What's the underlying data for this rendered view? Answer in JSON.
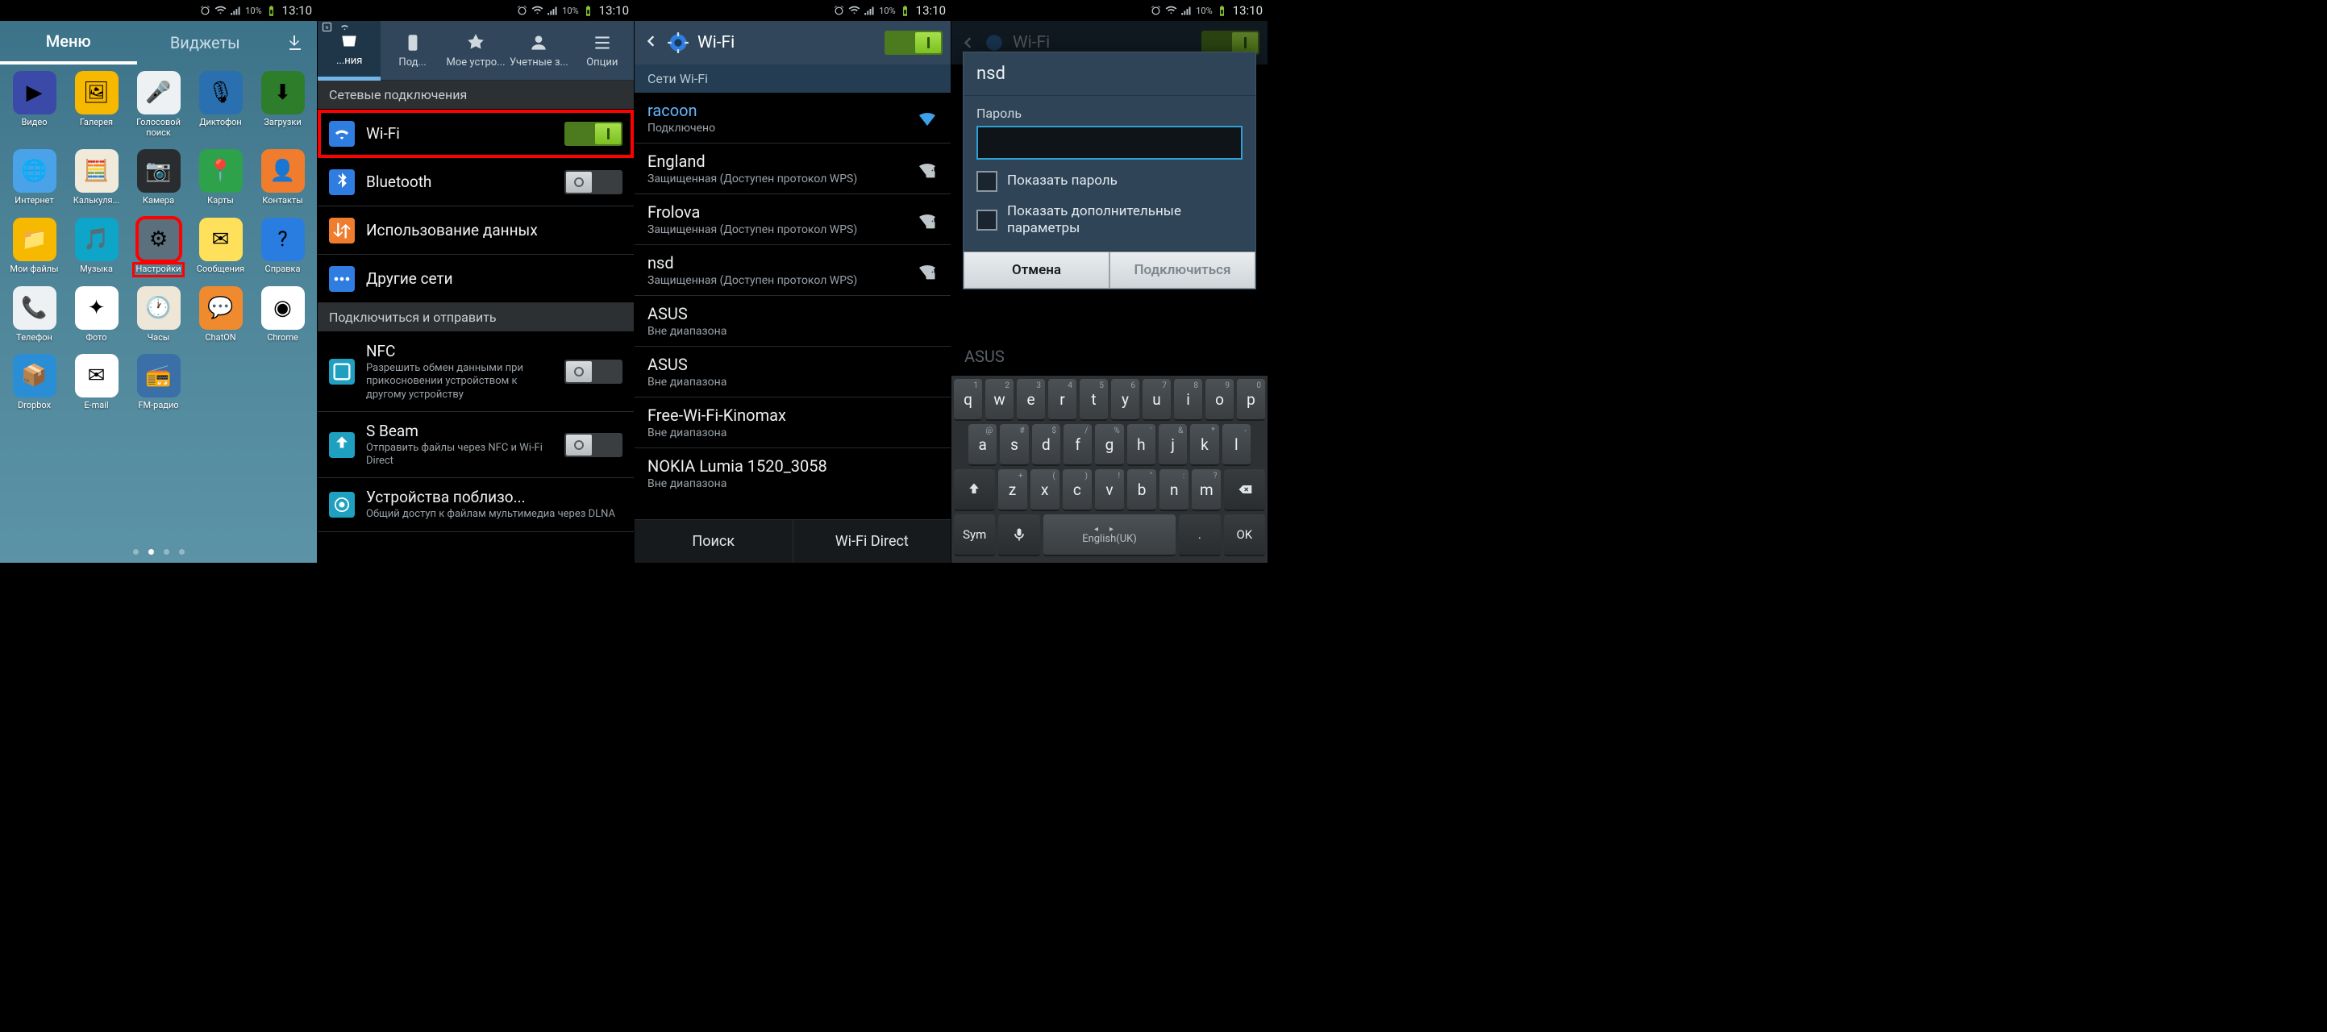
{
  "status": {
    "battery": "10%",
    "time": "13:10"
  },
  "p1": {
    "tabs": {
      "menu": "Меню",
      "widgets": "Виджеты"
    },
    "apps": [
      {
        "label": "Видео",
        "bg": "#3b4aa8",
        "glyph": "▶"
      },
      {
        "label": "Галерея",
        "bg": "#f7b800",
        "glyph": "🖼"
      },
      {
        "label": "Голосовой поиск",
        "bg": "#eef1f3",
        "glyph": "🎤"
      },
      {
        "label": "Диктофон",
        "bg": "#2a6fb0",
        "glyph": "🎙"
      },
      {
        "label": "Загрузки",
        "bg": "#2e7d2b",
        "glyph": "⬇"
      },
      {
        "label": "Интернет",
        "bg": "#4aa3e8",
        "glyph": "🌐"
      },
      {
        "label": "Калькуля...",
        "bg": "#f0eadb",
        "glyph": "🧮"
      },
      {
        "label": "Камера",
        "bg": "#2a2d2f",
        "glyph": "📷"
      },
      {
        "label": "Карты",
        "bg": "#2da24a",
        "glyph": "📍"
      },
      {
        "label": "Контакты",
        "bg": "#f07d2e",
        "glyph": "👤"
      },
      {
        "label": "Мои файлы",
        "bg": "#f7b800",
        "glyph": "📁"
      },
      {
        "label": "Музыка",
        "bg": "#0fa5c8",
        "glyph": "🎵"
      },
      {
        "label": "Настройки",
        "bg": "#5b6f7c",
        "glyph": "⚙",
        "hl": true
      },
      {
        "label": "Сообщения",
        "bg": "#ffe05a",
        "glyph": "✉"
      },
      {
        "label": "Справка",
        "bg": "#2a7de0",
        "glyph": "?"
      },
      {
        "label": "Телефон",
        "bg": "#eef1f3",
        "glyph": "📞"
      },
      {
        "label": "Фото",
        "bg": "#ffffff",
        "glyph": "✦"
      },
      {
        "label": "Часы",
        "bg": "#eee7d8",
        "glyph": "🕐"
      },
      {
        "label": "ChatON",
        "bg": "#f08a2e",
        "glyph": "💬"
      },
      {
        "label": "Chrome",
        "bg": "#ffffff",
        "glyph": "◉"
      },
      {
        "label": "Dropbox",
        "bg": "#2a8ed6",
        "glyph": "📦"
      },
      {
        "label": "E-mail",
        "bg": "#ffffff",
        "glyph": "✉"
      },
      {
        "label": "FM-радио",
        "bg": "#3a6fa8",
        "glyph": "📻"
      }
    ]
  },
  "p2": {
    "tabs": [
      {
        "label": "...ния",
        "active": true
      },
      {
        "label": "Под..."
      },
      {
        "label": "Мое устро..."
      },
      {
        "label": "Учетные з..."
      },
      {
        "label": "Опции"
      }
    ],
    "sections": [
      {
        "header": "Сетевые подключения",
        "rows": [
          {
            "title": "Wi-Fi",
            "icon": "wifi",
            "iconBg": "#2f7de0",
            "toggle": "on",
            "hl": true
          },
          {
            "title": "Bluetooth",
            "icon": "bt",
            "iconBg": "#2f7de0",
            "toggle": "off"
          },
          {
            "title": "Использование данных",
            "icon": "data",
            "iconBg": "#f07d2e"
          },
          {
            "title": "Другие сети",
            "icon": "more",
            "iconBg": "#2f7de0"
          }
        ]
      },
      {
        "header": "Подключиться и отправить",
        "rows": [
          {
            "title": "NFC",
            "sub": "Разрешить обмен данными при прикосновении устройством к другому устройству",
            "icon": "nfc",
            "iconBg": "#1fa0c0",
            "toggle": "off"
          },
          {
            "title": "S Beam",
            "sub": "Отправить файлы через NFC и Wi-Fi Direct",
            "icon": "sbeam",
            "iconBg": "#1fa0c0",
            "toggle": "off"
          },
          {
            "title": "Устройства поблизо...",
            "sub": "Общий доступ к файлам мультимедиа через DLNA",
            "icon": "nearby",
            "iconBg": "#1fa0c0"
          }
        ]
      }
    ]
  },
  "p3": {
    "title": "Wi-Fi",
    "section": "Сети Wi-Fi",
    "nets": [
      {
        "name": "racoon",
        "status": "Подключено",
        "conn": true,
        "lock": false
      },
      {
        "name": "England",
        "status": "Защищенная (Доступен протокол WPS)",
        "lock": true
      },
      {
        "name": "Frolova",
        "status": "Защищенная (Доступен протокол WPS)",
        "lock": true
      },
      {
        "name": "nsd",
        "status": "Защищенная (Доступен протокол WPS)",
        "lock": true
      },
      {
        "name": "ASUS",
        "status": "Вне диапазона"
      },
      {
        "name": "ASUS",
        "status": "Вне диапазона"
      },
      {
        "name": "Free-Wi-Fi-Kinomax",
        "status": "Вне диапазона"
      },
      {
        "name": "NOKIA Lumia 1520_3058",
        "status": "Вне диапазона"
      }
    ],
    "footer": {
      "search": "Поиск",
      "direct": "Wi-Fi Direct"
    }
  },
  "p4": {
    "title": "Wi-Fi",
    "bgItem": "ASUS",
    "dialog": {
      "title": "nsd",
      "passLabel": "Пароль",
      "show": "Показать пароль",
      "adv": "Показать дополнительные параметры",
      "cancel": "Отмена",
      "connect": "Подключиться"
    },
    "kbd": {
      "r1": [
        [
          "q",
          "1"
        ],
        [
          "w",
          "2"
        ],
        [
          "e",
          "3"
        ],
        [
          "r",
          "4"
        ],
        [
          "t",
          "5"
        ],
        [
          "y",
          "6"
        ],
        [
          "u",
          "7"
        ],
        [
          "i",
          "8"
        ],
        [
          "o",
          "9"
        ],
        [
          "p",
          "0"
        ]
      ],
      "r2": [
        [
          "a",
          "@"
        ],
        [
          "s",
          "#"
        ],
        [
          "d",
          "$"
        ],
        [
          "f",
          "/"
        ],
        [
          "g",
          "%"
        ],
        [
          "h",
          "'"
        ],
        [
          "j",
          "&"
        ],
        [
          "k",
          "*"
        ],
        [
          "l",
          "-"
        ]
      ],
      "r3": [
        [
          "z",
          "+"
        ],
        [
          "x",
          "("
        ],
        [
          "c",
          ")"
        ],
        [
          "v",
          "!"
        ],
        [
          "b",
          "\""
        ],
        [
          "n",
          ":"
        ],
        [
          "m",
          "?"
        ]
      ],
      "lang": "English(UK)",
      "sym": "Sym",
      "ok": "OK"
    }
  }
}
